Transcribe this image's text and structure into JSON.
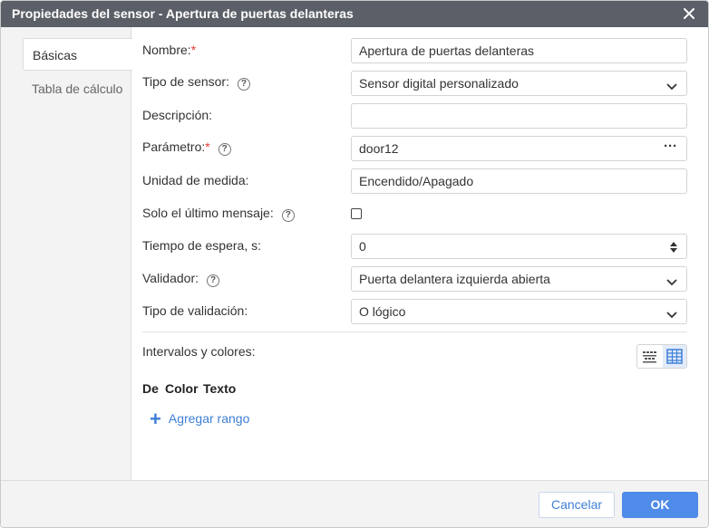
{
  "dialog": {
    "title": "Propiedades del sensor - Apertura de puertas delanteras",
    "close_icon": "close-icon"
  },
  "sidebar": {
    "tabs": [
      {
        "label": "Básicas",
        "active": true
      },
      {
        "label": "Tabla de cálculo",
        "active": false
      }
    ]
  },
  "form": {
    "name": {
      "label": "Nombre:",
      "required_mark": "*",
      "value": "Apertura de puertas delanteras"
    },
    "sensor_type": {
      "label": "Tipo de sensor:",
      "help": "?",
      "value": "Sensor digital personalizado"
    },
    "description": {
      "label": "Descripción:",
      "value": ""
    },
    "parameter": {
      "label": "Parámetro:",
      "required_mark": "*",
      "help": "?",
      "value": "door12",
      "more": "···"
    },
    "unit": {
      "label": "Unidad de medida:",
      "value": "Encendido/Apagado"
    },
    "last_message_only": {
      "label": "Solo el último mensaje:",
      "help": "?",
      "checked": false
    },
    "timeout": {
      "label": "Tiempo de espera, s:",
      "value": "0"
    },
    "validator": {
      "label": "Validador:",
      "help": "?",
      "value": "Puerta delantera izquierda abierta"
    },
    "validation_type": {
      "label": "Tipo de validación:",
      "value": "O lógico"
    }
  },
  "intervals": {
    "label": "Intervalos y colores:",
    "columns": [
      "De",
      "Color",
      "Texto"
    ],
    "add_range": "Agregar rango",
    "view_mode": "table"
  },
  "footer": {
    "cancel": "Cancelar",
    "ok": "OK"
  },
  "colors": {
    "titlebar": "#5b5f67",
    "accent": "#4f8be8",
    "required": "#e53935"
  }
}
